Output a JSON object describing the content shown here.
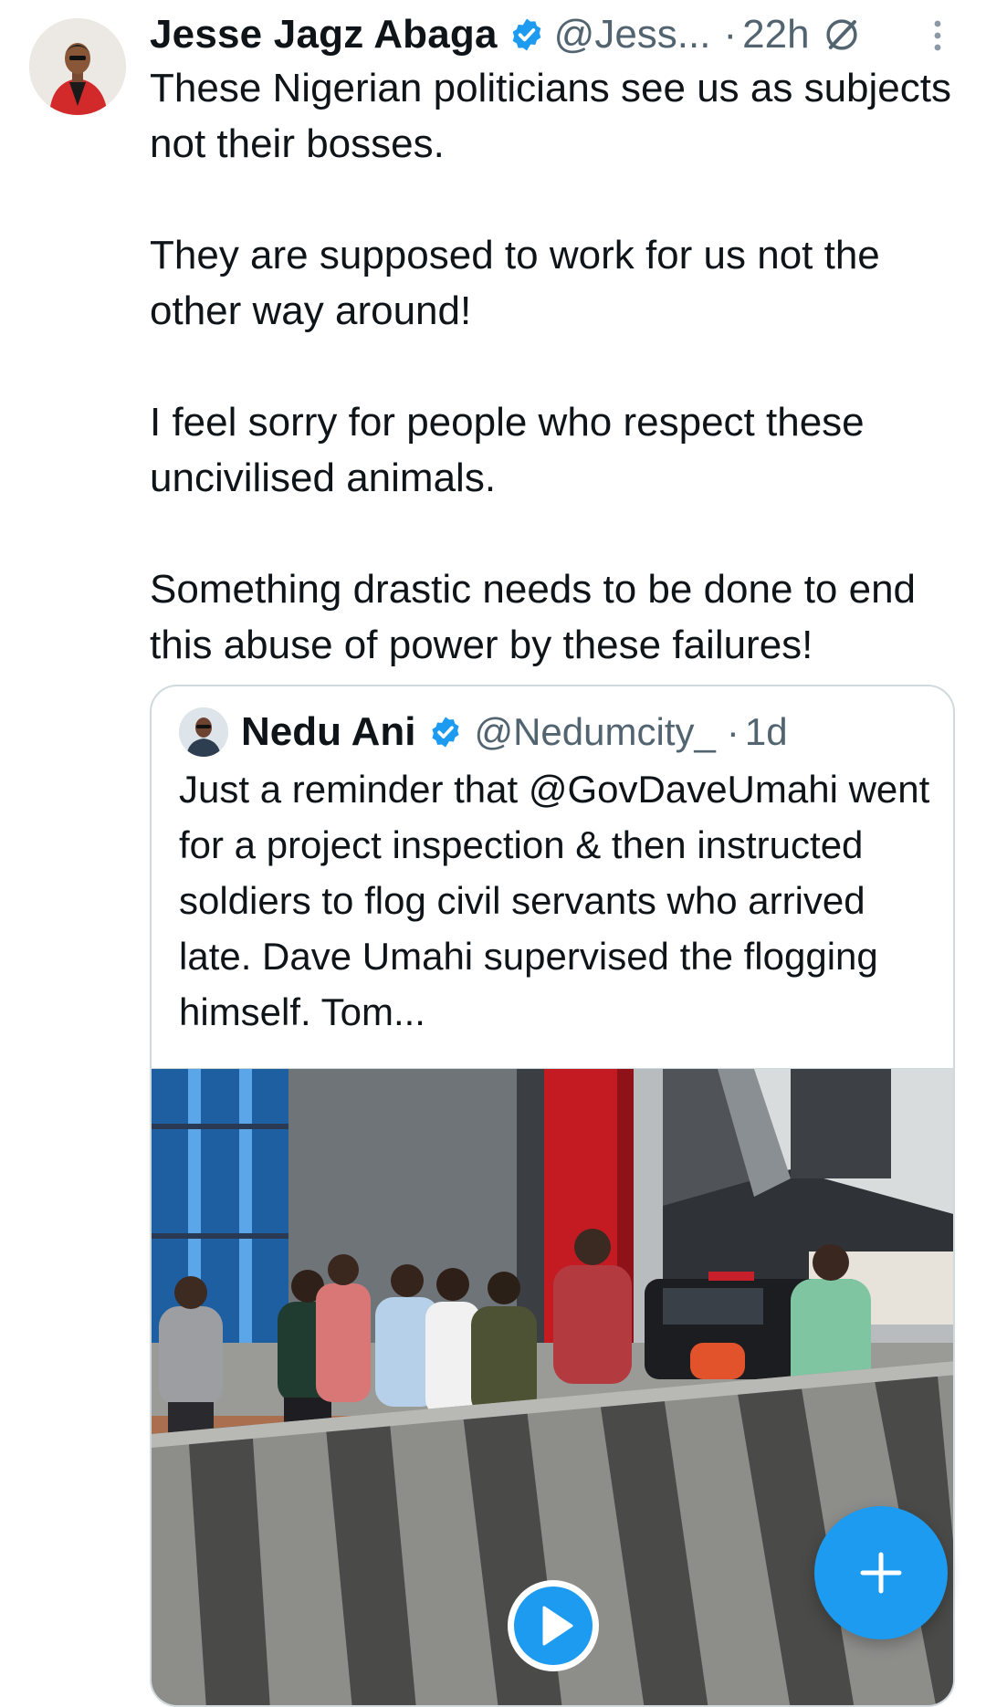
{
  "tweet": {
    "author_name": "Jesse Jagz Abaga",
    "author_handle": "@Jess...",
    "separator": "·",
    "time": "22h",
    "paragraphs": [
      "These Nigerian politicians see us as subjects not their bosses.",
      "They are supposed to work for us not the other way around!",
      "I feel sorry for people who respect these uncivilised animals.",
      "Something drastic needs to be done to end this abuse of power by these failures!"
    ]
  },
  "quoted_tweet": {
    "author_name": "Nedu Ani",
    "author_handle": "@Nedumcity_",
    "separator": "·",
    "time": "1d",
    "text": "Just a reminder that @GovDaveUmahi went for a project inspection & then instructed soldiers to flog civil servants who arrived late. Dave Umahi supervised the flogging himself. Tom..."
  },
  "icons": {
    "verified": "verified-badge-icon",
    "edited": "edit-history-icon",
    "more": "more-options-icon",
    "play": "play-icon",
    "compose": "plus-icon"
  },
  "colors": {
    "accent": "#1d9bf0",
    "text": "#0f1419",
    "secondary_text": "#536471",
    "border": "#cfd9de"
  }
}
